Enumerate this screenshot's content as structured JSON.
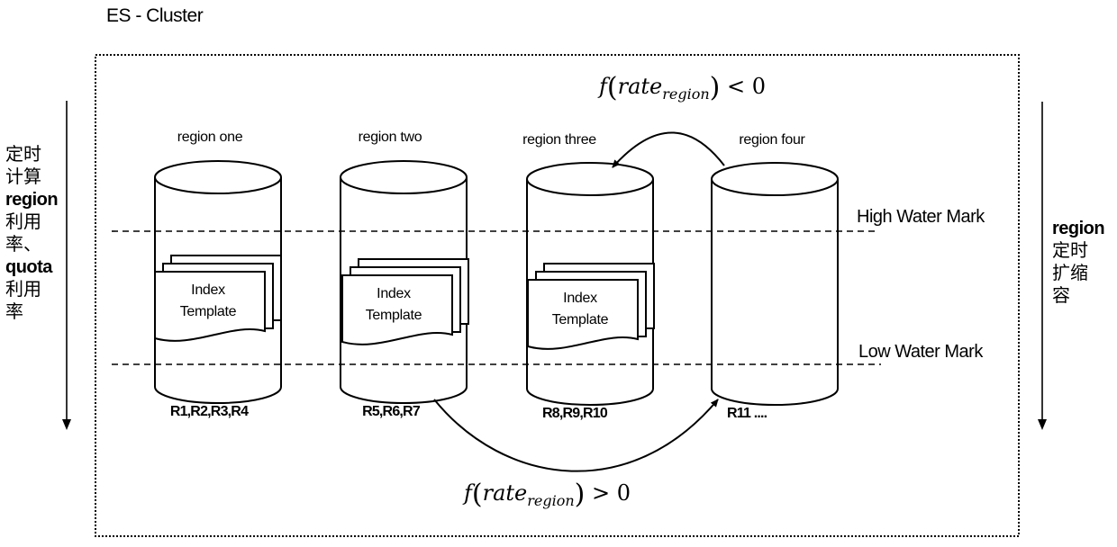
{
  "title": "ES - Cluster",
  "left_annotation": {
    "lines": [
      "定时",
      "计算",
      "region",
      "利用",
      "率、",
      "quota",
      "利用",
      "率"
    ]
  },
  "right_annotation": {
    "lines": [
      "region",
      "定时",
      "扩缩",
      "容"
    ]
  },
  "regions": [
    {
      "name": "region one",
      "replicas": "R1,R2,R3,R4",
      "has_template": true
    },
    {
      "name": "region two",
      "replicas": "R5,R6,R7",
      "has_template": true
    },
    {
      "name": "region three",
      "replicas": "R8,R9,R10",
      "has_template": true
    },
    {
      "name": "region four",
      "replicas": "R11 ....",
      "has_template": false
    }
  ],
  "template_label": {
    "line1": "Index",
    "line2": "Template"
  },
  "water_marks": {
    "high": "High Water Mark",
    "low": "Low Water Mark"
  },
  "formulas": {
    "top": {
      "func": "f",
      "var": "rate",
      "sub": "region",
      "op": "<",
      "rhs": "0"
    },
    "bottom": {
      "func": "f",
      "var": "rate",
      "sub": "region",
      "op": ">",
      "rhs": "0"
    }
  },
  "flows": [
    {
      "from": "region four",
      "to": "region three",
      "condition": "top"
    },
    {
      "from": "region two",
      "to": "region four",
      "condition": "bottom"
    }
  ]
}
